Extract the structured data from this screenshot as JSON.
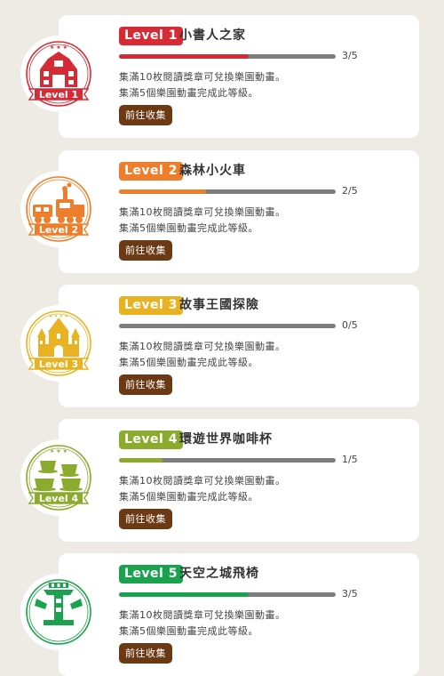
{
  "levels": [
    {
      "tag": "Level 1",
      "title": "小書人之家",
      "progress_text": "3/5",
      "progress": 0.6,
      "desc1": "集滿10枚閱讀獎章可兌換樂園動畫。",
      "desc2": "集滿5個樂園動畫完成此等級。",
      "button": "前往收集",
      "badge_label": "Level 1",
      "color": "#d62b36",
      "icon": "house-icon"
    },
    {
      "tag": "Level 2",
      "title": "森林小火車",
      "progress_text": "2/5",
      "progress": 0.4,
      "desc1": "集滿10枚閱讀獎章可兌換樂園動畫。",
      "desc2": "集滿5個樂園動畫完成此等級。",
      "button": "前往收集",
      "badge_label": "Level 2",
      "color": "#ee7e2c",
      "icon": "train-icon"
    },
    {
      "tag": "Level 3",
      "title": "故事王國探險",
      "progress_text": "0/5",
      "progress": 0,
      "desc1": "集滿10枚閱讀獎章可兌換樂園動畫。",
      "desc2": "集滿5個樂園動畫完成此等級。",
      "button": "前往收集",
      "badge_label": "Level 3",
      "color": "#e9b222",
      "icon": "castle-icon"
    },
    {
      "tag": "Level 4",
      "title": "環遊世界咖啡杯",
      "progress_text": "1/5",
      "progress": 0.2,
      "desc1": "集滿10枚閱讀獎章可兌換樂園動畫。",
      "desc2": "集滿5個樂園動畫完成此等級。",
      "button": "前往收集",
      "badge_label": "Level 4",
      "color": "#8aab2d",
      "icon": "teacup-icon"
    },
    {
      "tag": "Level 5",
      "title": "天空之城飛椅",
      "progress_text": "3/5",
      "progress": 0.6,
      "desc1": "集滿10枚閱讀獎章可兌換樂園動畫。",
      "desc2": "集滿5個樂園動畫完成此等級。",
      "button": "前往收集",
      "badge_label": "Level 5",
      "color": "#1aa24f",
      "icon": "swing-chair-icon"
    }
  ]
}
